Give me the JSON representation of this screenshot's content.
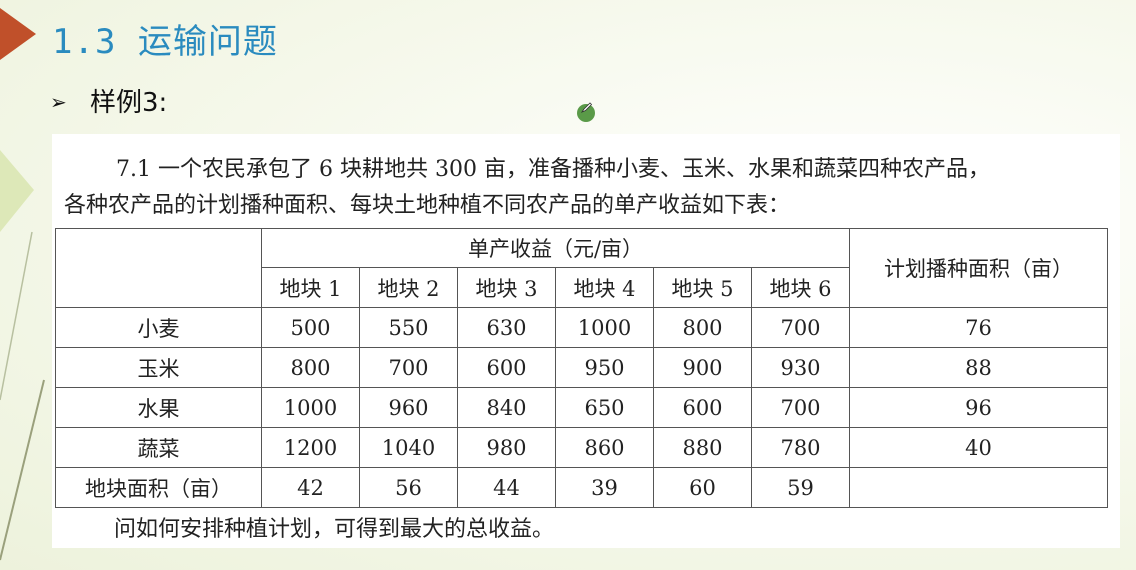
{
  "slide": {
    "title": "1.3 运输问题",
    "subtitle_bullet": "➢",
    "subtitle": "样例3:",
    "cursor_icon": "pen-icon",
    "marker_color": "#c0502a",
    "title_color": "#2a8bbf"
  },
  "problem": {
    "line1": "7.1 一个农民承包了 6 块耕地共 300 亩，准备播种小麦、玉米、水果和蔬菜四种农产品，",
    "line2": "各种农产品的计划播种面积、每块土地种植不同农产品的单产收益如下表：",
    "question": "问如何安排种植计划，可得到最大的总收益。"
  },
  "table": {
    "group_header": "单产收益（元/亩）",
    "area_header": "计划播种面积（亩）",
    "plots": [
      "地块 1",
      "地块 2",
      "地块 3",
      "地块 4",
      "地块 5",
      "地块 6"
    ],
    "rows": [
      {
        "crop": "小麦",
        "values": [
          "500",
          "550",
          "630",
          "1000",
          "800",
          "700"
        ],
        "area": "76"
      },
      {
        "crop": "玉米",
        "values": [
          "800",
          "700",
          "600",
          "950",
          "900",
          "930"
        ],
        "area": "88"
      },
      {
        "crop": "水果",
        "values": [
          "1000",
          "960",
          "840",
          "650",
          "600",
          "700"
        ],
        "area": "96"
      },
      {
        "crop": "蔬菜",
        "values": [
          "1200",
          "1040",
          "980",
          "860",
          "880",
          "780"
        ],
        "area": "40"
      }
    ],
    "footer_label": "地块面积（亩）",
    "plot_areas": [
      "42",
      "56",
      "44",
      "39",
      "60",
      "59"
    ]
  }
}
